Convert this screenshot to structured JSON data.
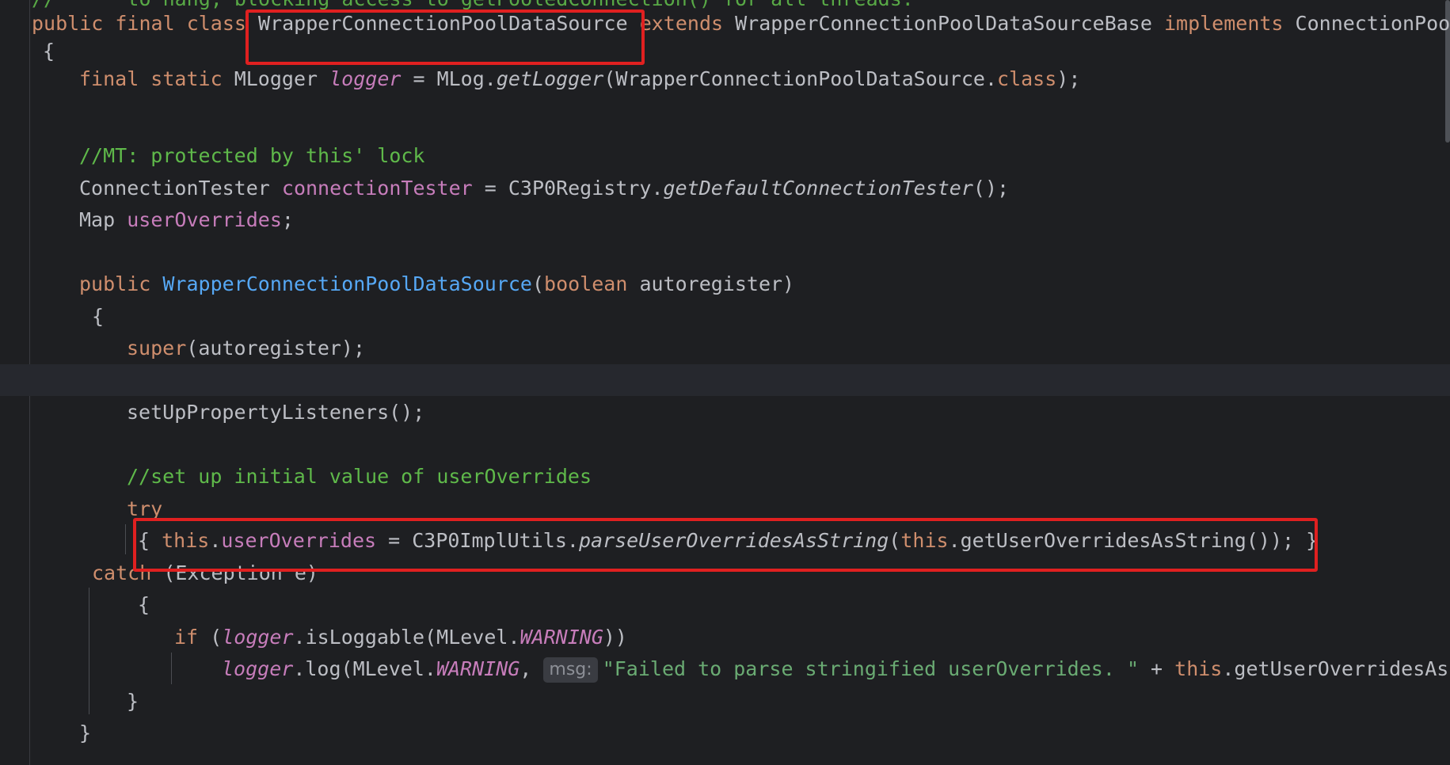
{
  "editor": {
    "top_comment_fragment": "//      to hang, blocking access to getPooledConnection() for all threads.",
    "class_decl": {
      "kw1": "public",
      "kw2": "final",
      "kw3": "class",
      "class_name": "WrapperConnectionPoolDataSource",
      "extends_kw": "extends",
      "base": "WrapperConnectionPoolDataSourceBase",
      "implements_kw": "implements",
      "iface": "ConnectionPool"
    },
    "open_brace": "{",
    "logger_line": {
      "kw": "final static",
      "type": "MLogger",
      "name": "logger",
      "rest1": " = MLog.",
      "call": "getLogger",
      "rest2": "(WrapperConnectionPoolDataSource.",
      "cls": "class",
      "rest3": ");"
    },
    "comment_mt": "//MT: protected by this' lock",
    "tester_line": {
      "type": "ConnectionTester",
      "name": "connectionTester",
      "rest1": " = C3P0Registry.",
      "call": "getDefaultConnectionTester",
      "rest2": "();"
    },
    "map_line": {
      "type": "Map",
      "name": "userOverrides",
      "semi": ";"
    },
    "ctor_line": {
      "kw": "public",
      "name": "WrapperConnectionPoolDataSource",
      "p1": "(",
      "ptype": "boolean",
      "pname": " autoregister)"
    },
    "ctor_brace": "{",
    "super_line": {
      "kw": "super",
      "rest": "(autoregister);"
    },
    "setup_line": "setUpPropertyListeners();",
    "comment_init": "//set up initial value of userOverrides",
    "try_kw": "try",
    "try_body": {
      "open": "{ ",
      "this1": "this",
      "dot": ".",
      "field": "userOverrides",
      "mid": " = C3P0ImplUtils.",
      "call": "parseUserOverridesAsString",
      "p": "(",
      "this2": "this",
      "tail": ".getUserOverridesAsString()); }"
    },
    "catch_line": {
      "kw": "catch",
      "rest": " (Exception e)"
    },
    "catch_brace": "{",
    "if_line": {
      "kw": "if",
      "p": " (",
      "logger": "logger",
      "mid": ".isLoggable(MLevel.",
      "level": "WARNING",
      "end": "))"
    },
    "log_line": {
      "logger": "logger",
      "mid": ".log(MLevel.",
      "level": "WARNING",
      "comma": ", ",
      "hint": "msg:",
      "str": "\"Failed to parse stringified userOverrides. \"",
      "plus": " + ",
      "this": "this",
      "tail": ".getUserOverridesAs"
    },
    "close_inner": "}",
    "close_ctor": "}"
  }
}
